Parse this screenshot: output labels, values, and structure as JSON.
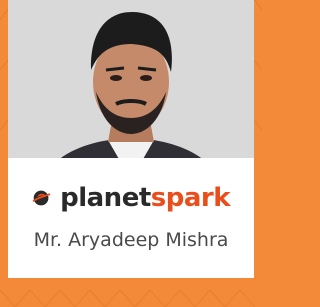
{
  "logo": {
    "part1": "planet",
    "part2": "spark"
  },
  "name": "Mr. Aryadeep Mishra",
  "icons": {
    "logo": "planet-logo-icon"
  },
  "colors": {
    "frame": "#f28a3a",
    "brand_dark": "#2a2a2a",
    "brand_orange": "#e94e1b",
    "card": "#ffffff",
    "name_text": "#4a4a4a"
  }
}
